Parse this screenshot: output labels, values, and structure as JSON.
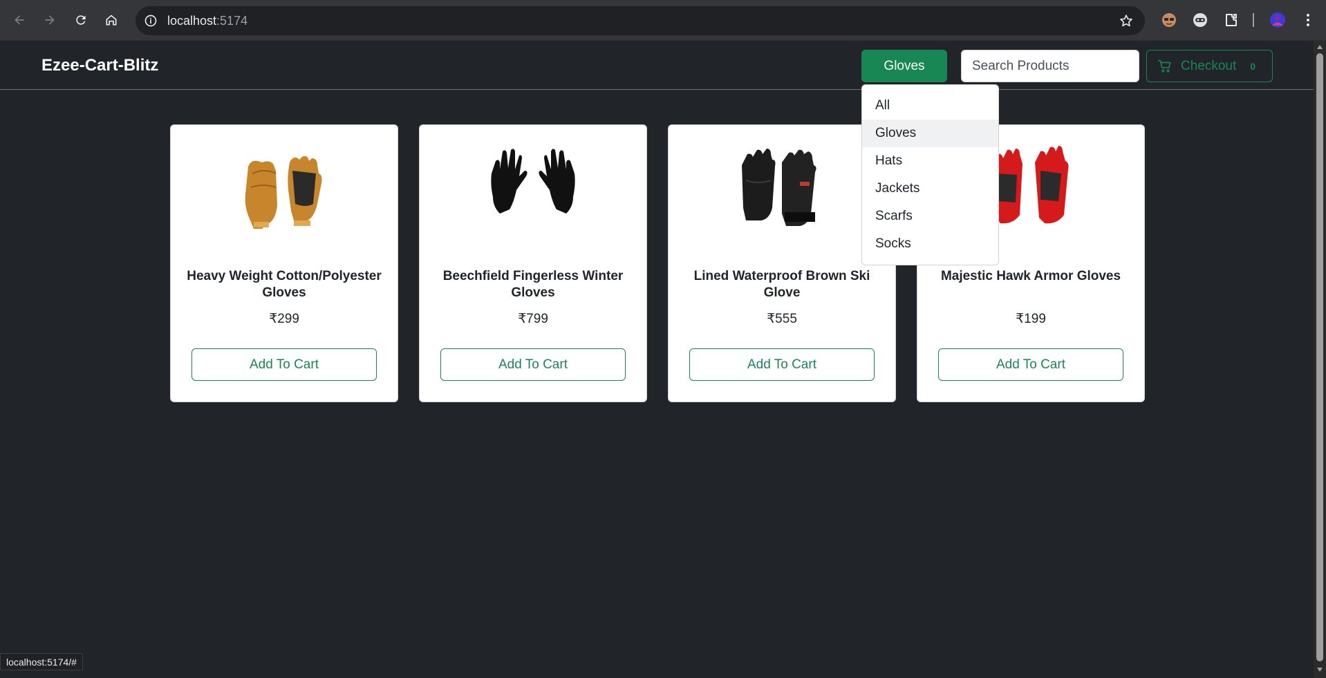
{
  "browser": {
    "url_host": "localhost",
    "url_port": ":5174",
    "status_text": "localhost:5174/#"
  },
  "navbar": {
    "brand": "Ezee-Cart-Blitz",
    "category_button": "Gloves",
    "search_placeholder": "Search Products",
    "checkout_label": "Checkout",
    "cart_count": "0"
  },
  "dropdown": {
    "items": [
      "All",
      "Gloves",
      "Hats",
      "Jackets",
      "Scarfs",
      "Socks"
    ],
    "active": "Gloves"
  },
  "products": [
    {
      "name": "Heavy Weight Cotton/Polyester Gloves",
      "price": "₹299",
      "button": "Add To Cart",
      "image": "tan-leather-work-gloves"
    },
    {
      "name": "Beechfield Fingerless Winter Gloves",
      "price": "₹799",
      "button": "Add To Cart",
      "image": "black-knit-gloves"
    },
    {
      "name": "Lined Waterproof Brown Ski Glove",
      "price": "₹555",
      "button": "Add To Cart",
      "image": "black-ski-gloves"
    },
    {
      "name": "Majestic Hawk Armor Gloves",
      "price": "₹199",
      "button": "Add To Cart",
      "image": "red-black-gloves"
    }
  ],
  "colors": {
    "page_bg": "#212529",
    "success": "#198754",
    "card_bg": "#ffffff"
  }
}
